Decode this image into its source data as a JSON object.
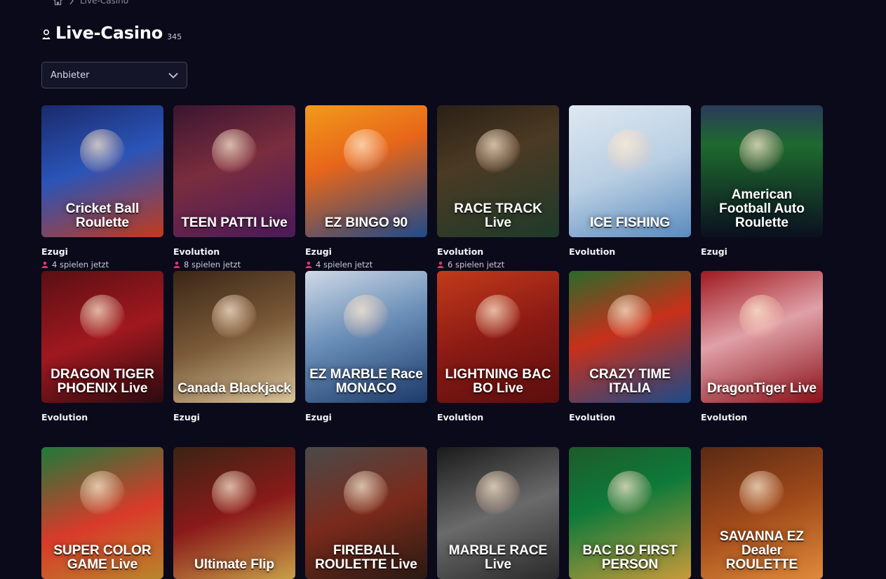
{
  "breadcrumb": {
    "current": "Live-Casino"
  },
  "header": {
    "title": "Live-Casino",
    "count": "345"
  },
  "filter": {
    "provider_label": "Anbieter"
  },
  "games": [
    {
      "title": "Cricket Ball Roulette",
      "provider": "Ezugi",
      "players": "4 spielen jetzt",
      "bg": "linear-gradient(160deg,#1b2a6b 0%,#2a54b8 45%,#c23a1b 100%)"
    },
    {
      "title": "TEEN PATTI Live",
      "provider": "Evolution",
      "players": "8 spielen jetzt",
      "bg": "linear-gradient(160deg,#3b1530 0%,#7a2d3e 45%,#4a1a5b 100%)"
    },
    {
      "title": "EZ BINGO 90",
      "provider": "Ezugi",
      "players": "4 spielen jetzt",
      "bg": "linear-gradient(160deg,#f39a1a 0%,#e7661a 40%,#1e4a8a 100%)"
    },
    {
      "title": "RACE TRACK Live",
      "provider": "Evolution",
      "players": "6 spielen jetzt",
      "bg": "linear-gradient(160deg,#2a2016 0%,#4b3a24 40%,#1e3a2a 100%)"
    },
    {
      "title": "ICE FISHING",
      "provider": "Evolution",
      "players": "",
      "bg": "linear-gradient(160deg,#dfe8f1 0%,#b9cfe2 50%,#5a8bbf 100%)"
    },
    {
      "title": "American Football Auto Roulette",
      "provider": "Ezugi",
      "players": "",
      "bg": "linear-gradient(180deg,#2a3a5a 0%,#1e6a2e 30%,#0b1020 100%)"
    },
    {
      "title": "DRAGON TIGER PHOENIX Live",
      "provider": "Evolution",
      "players": "",
      "bg": "linear-gradient(160deg,#5a0f14 0%,#a0181f 50%,#2a0b10 100%)"
    },
    {
      "title": "Canada Blackjack",
      "provider": "Ezugi",
      "players": "",
      "bg": "linear-gradient(160deg,#3a2617 0%,#7a5a38 50%,#d9c49a 100%)"
    },
    {
      "title": "EZ MARBLE Race MONACO",
      "provider": "Ezugi",
      "players": "",
      "bg": "linear-gradient(160deg,#cfd9e6 0%,#6a8fb8 45%,#1d3a6a 100%)"
    },
    {
      "title": "LIGHTNING BAC BO Live",
      "provider": "Evolution",
      "players": "",
      "bg": "linear-gradient(160deg,#c23a1a 0%,#8a1a14 50%,#5a0e0e 100%)"
    },
    {
      "title": "CRAZY TIME ITALIA",
      "provider": "Evolution",
      "players": "",
      "bg": "linear-gradient(160deg,#2a6a2a 0%,#c8301a 45%,#1a4a8a 100%)"
    },
    {
      "title": "DragonTiger Live",
      "provider": "Evolution",
      "players": "",
      "bg": "linear-gradient(160deg,#a0181f 0%,#e0a0a8 45%,#8a1018 100%)"
    },
    {
      "title": "SUPER COLOR GAME Live",
      "provider": "",
      "players": "",
      "bg": "linear-gradient(160deg,#1e7a3a 0%,#d93a2a 55%,#b8862a 100%)"
    },
    {
      "title": "Ultimate Flip",
      "provider": "",
      "players": "",
      "bg": "linear-gradient(160deg,#3a2414 0%,#8a1a1a 50%,#c8a048 100%)"
    },
    {
      "title": "FIREBALL ROULETTE Live",
      "provider": "",
      "players": "",
      "bg": "linear-gradient(160deg,#4a4a4a 0%,#7a2a1a 50%,#2a1a14 100%)"
    },
    {
      "title": "MARBLE RACE Live",
      "provider": "",
      "players": "",
      "bg": "linear-gradient(160deg,#1a1a1a 0%,#6a6a6a 50%,#2a2a2a 100%)"
    },
    {
      "title": "BAC BO FIRST PERSON",
      "provider": "",
      "players": "",
      "bg": "linear-gradient(160deg,#1e5a2a 0%,#0e7a3a 40%,#c89a3a 100%)"
    },
    {
      "title": "SAVANNA EZ Dealer ROULETTE",
      "provider": "",
      "players": "",
      "bg": "linear-gradient(160deg,#5a2a14 0%,#a04a1a 50%,#e08a3a 100%)"
    }
  ]
}
